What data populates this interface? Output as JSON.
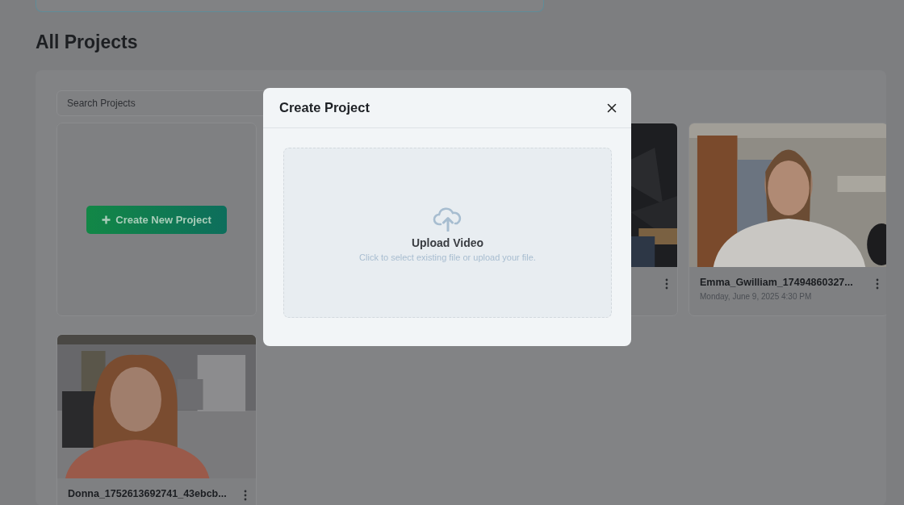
{
  "page": {
    "title": "All Projects"
  },
  "search": {
    "placeholder": "Search Projects"
  },
  "projects": [
    {
      "kind": "create",
      "label": "Create New Project"
    },
    {
      "kind": "video"
    },
    {
      "kind": "video",
      "title": "Emma_Gwilliam_17494860327...",
      "date": "Monday, June 9, 2025 4:30 PM"
    },
    {
      "kind": "video",
      "title": "Donna_1752613692741_43ebcb..."
    }
  ],
  "modal": {
    "title": "Create Project",
    "upload": {
      "title": "Upload Video",
      "hint": "Click to select existing file or upload your file."
    }
  }
}
